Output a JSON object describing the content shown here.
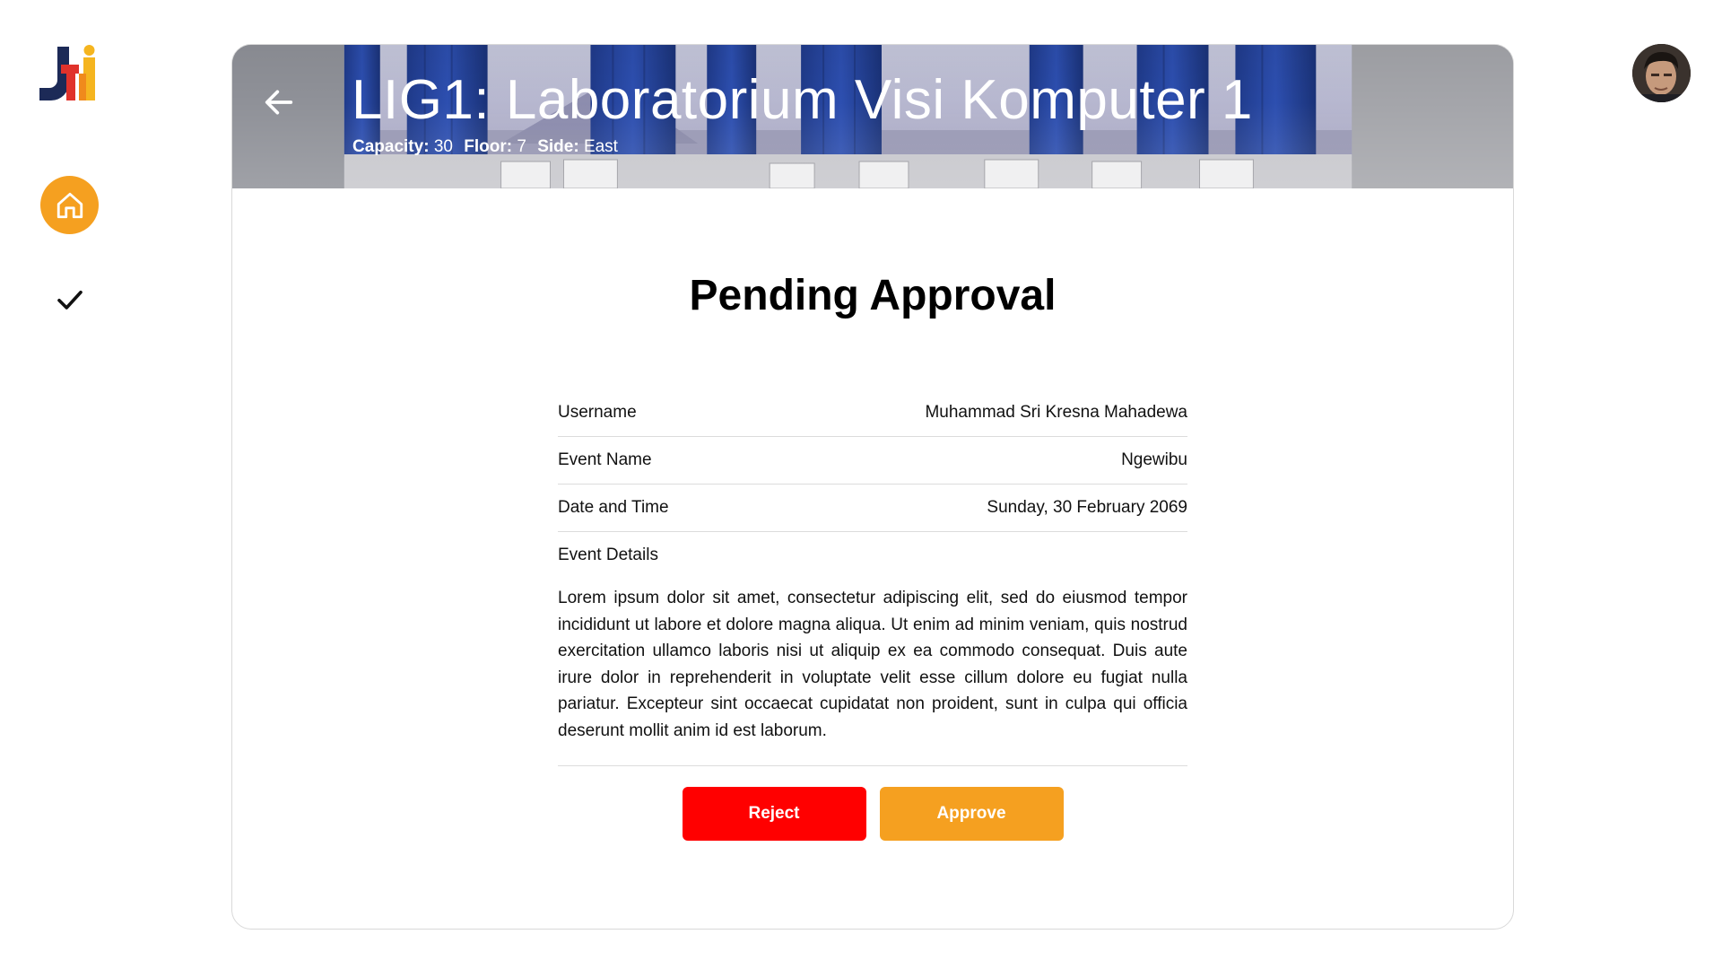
{
  "app": {
    "logo_text": "JTI"
  },
  "nav": {
    "items": [
      {
        "icon": "home-icon",
        "active": true
      },
      {
        "icon": "check-icon",
        "active": false
      }
    ],
    "accent": "#F5A020"
  },
  "user": {
    "avatar_icon": "avatar"
  },
  "room": {
    "title": "LIG1: Laboratorium Visi Komputer 1",
    "capacity_label": "Capacity:",
    "capacity_value": "30",
    "floor_label": "Floor:",
    "floor_value": "7",
    "side_label": "Side:",
    "side_value": "East"
  },
  "main": {
    "heading": "Pending Approval",
    "fields": [
      {
        "label": "Username",
        "value": "Muhammad Sri Kresna Mahadewa"
      },
      {
        "label": "Event Name",
        "value": "Ngewibu"
      },
      {
        "label": "Date and Time",
        "value": "Sunday, 30 February 2069"
      }
    ],
    "details_label": "Event Details",
    "details_text": "Lorem ipsum dolor sit amet, consectetur adipiscing elit, sed do eiusmod tempor incididunt ut labore et dolore magna aliqua. Ut enim ad minim veniam, quis nostrud exercitation ullamco laboris nisi ut aliquip ex ea commodo consequat. Duis aute irure dolor in reprehenderit in voluptate velit esse cillum dolore eu fugiat nulla pariatur. Excepteur sint occaecat cupidatat non proident, sunt in culpa qui officia deserunt mollit anim id est laborum."
  },
  "actions": {
    "reject_label": "Reject",
    "approve_label": "Approve",
    "reject_color": "#FF0000",
    "approve_color": "#F5A020"
  }
}
